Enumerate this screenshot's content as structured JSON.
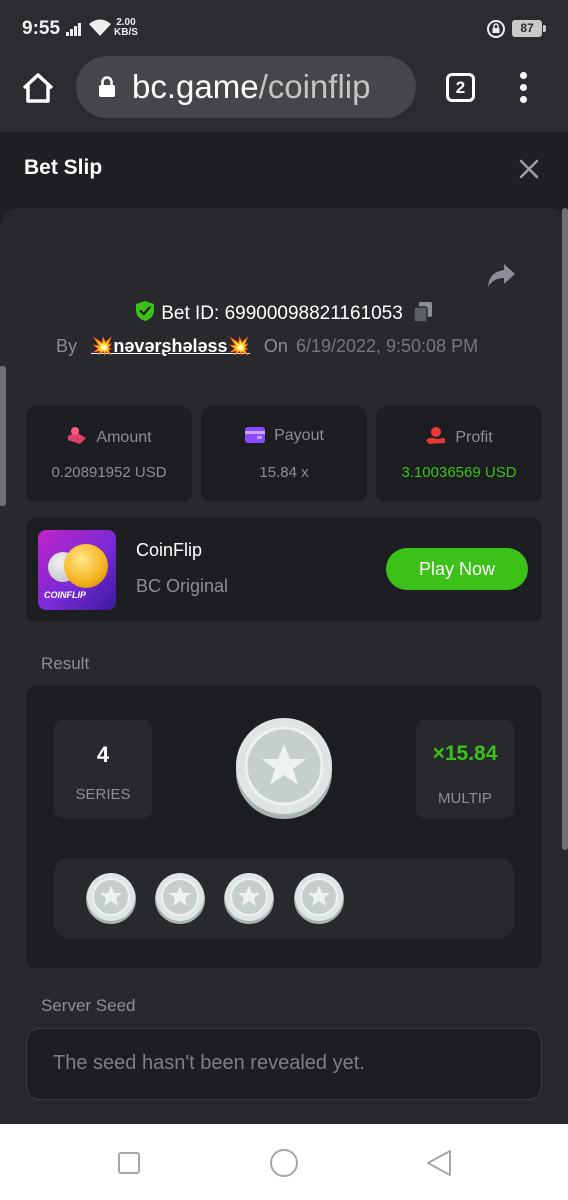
{
  "status_bar": {
    "time": "9:55",
    "net_speed_value": "2.00",
    "net_speed_unit": "KB/S",
    "battery": "87"
  },
  "browser": {
    "url_host": "bc.game",
    "url_path": "/coinflip",
    "tab_count": "2"
  },
  "slip": {
    "title": "Bet Slip"
  },
  "bet": {
    "id_label": "Bet ID:",
    "id": "69900098821161053",
    "by_label": "By",
    "user": "💥nəvərʂhələss💥",
    "on_label": "On",
    "date": "6/19/2022, 9:50:08 PM"
  },
  "stats": {
    "amount_label": "Amount",
    "amount_value": "0.20891952 USD",
    "payout_label": "Payout",
    "payout_value": "15.84 x",
    "profit_label": "Profit",
    "profit_value": "3.10036569 USD",
    "profit_color": "#3bc117"
  },
  "game": {
    "thumb_text": "COINFLIP",
    "name": "CoinFlip",
    "subtitle": "BC Original",
    "play_label": "Play Now",
    "accent": "#3bc117"
  },
  "result": {
    "label": "Result",
    "series_value": "4",
    "series_label": "SERIES",
    "multiplier_value": "×15.84",
    "multiplier_label": "MULTIP",
    "history_count": 4
  },
  "seed": {
    "label": "Server Seed",
    "text": "The seed hasn't been revealed yet."
  }
}
